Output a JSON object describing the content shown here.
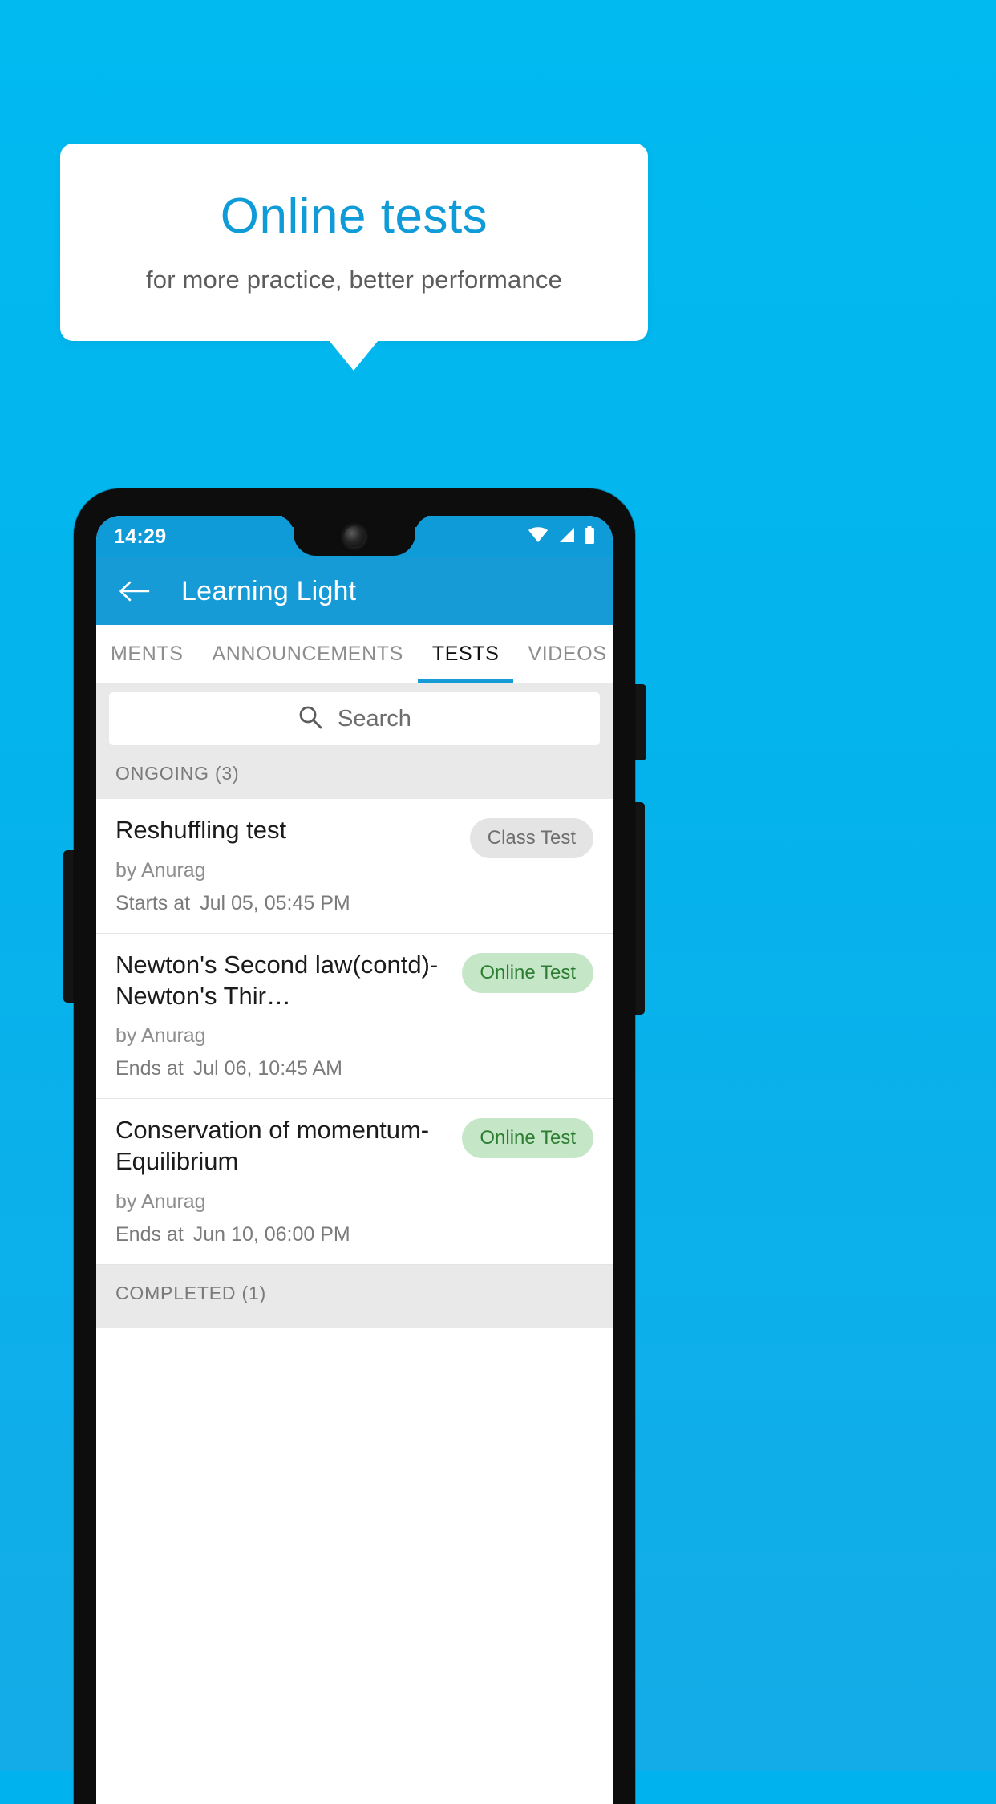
{
  "promo": {
    "title": "Online tests",
    "subtitle": "for more practice, better performance"
  },
  "phone": {
    "status_bar": {
      "time": "14:29",
      "icons": [
        "wifi-icon",
        "signal-icon",
        "battery-icon"
      ]
    },
    "app_bar": {
      "back_icon": "back-arrow-icon",
      "title": "Learning Light"
    },
    "tabs": [
      {
        "label": "MENTS",
        "active": false
      },
      {
        "label": "ANNOUNCEMENTS",
        "active": false
      },
      {
        "label": "TESTS",
        "active": true
      },
      {
        "label": "VIDEOS",
        "active": false
      }
    ],
    "search": {
      "icon": "search-icon",
      "placeholder": "Search"
    },
    "sections": [
      {
        "title": "ONGOING (3)"
      },
      {
        "title": "COMPLETED (1)"
      }
    ],
    "tests": [
      {
        "title": "Reshuffling test",
        "author": "by Anurag",
        "time_label": "Starts at",
        "time_value": "Jul 05, 05:45 PM",
        "badge": "Class Test",
        "badge_kind": "gray"
      },
      {
        "title": "Newton's Second law(contd)-Newton's Thir…",
        "author": "by Anurag",
        "time_label": "Ends at",
        "time_value": "Jul 06, 10:45 AM",
        "badge": "Online Test",
        "badge_kind": "green"
      },
      {
        "title": "Conservation of momentum-Equilibrium",
        "author": "by Anurag",
        "time_label": "Ends at",
        "time_value": "Jun 10, 06:00 PM",
        "badge": "Online Test",
        "badge_kind": "green"
      }
    ]
  },
  "colors": {
    "background_blue": "#00baf0",
    "app_bar_blue": "#169bd7",
    "promo_title_blue": "#0f9ad8",
    "badge_green_bg": "#c6e7c7",
    "badge_green_text": "#2c7d31",
    "badge_gray_bg": "#e4e4e4",
    "badge_gray_text": "#6e6e6e"
  }
}
